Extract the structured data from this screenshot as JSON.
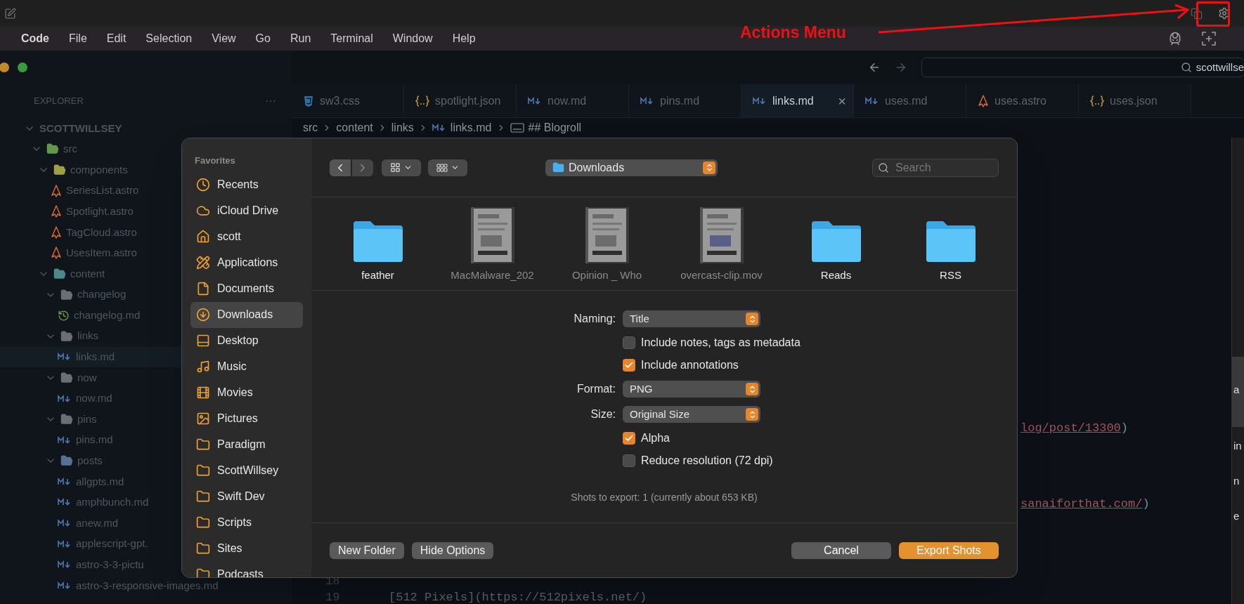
{
  "menu_bar": {
    "app_name": "Code",
    "menus": [
      "File",
      "Edit",
      "Selection",
      "View",
      "Go",
      "Run",
      "Terminal",
      "Window",
      "Help"
    ]
  },
  "annotation": {
    "text": "Actions Menu"
  },
  "command_center": {
    "value": "scottwillse"
  },
  "explorer": {
    "title": "EXPLORER",
    "more": "···",
    "root": {
      "label": "SCOTTWILLSEY",
      "kind": "root",
      "expanded": true,
      "children": [
        {
          "label": "src",
          "kind": "folder",
          "color": "#5f9a4a",
          "expanded": true,
          "selected": false,
          "children": [
            {
              "label": "components",
              "kind": "folder",
              "color": "#a0a040",
              "expanded": true,
              "selected": false,
              "children": [
                {
                  "label": "SeriesList.astro",
                  "kind": "astro",
                  "selected": false
                },
                {
                  "label": "Spotlight.astro",
                  "kind": "astro",
                  "selected": false
                },
                {
                  "label": "TagCloud.astro",
                  "kind": "astro",
                  "selected": false
                },
                {
                  "label": "UsesItem.astro",
                  "kind": "astro",
                  "selected": false
                }
              ]
            },
            {
              "label": "content",
              "kind": "folder",
              "color": "#4a8a8a",
              "expanded": true,
              "selected": false,
              "children": [
                {
                  "label": "changelog",
                  "kind": "folder",
                  "color": "#6a6f75",
                  "expanded": true,
                  "selected": false,
                  "children": [
                    {
                      "label": "changelog.md",
                      "kind": "changelog",
                      "selected": false
                    }
                  ]
                },
                {
                  "label": "links",
                  "kind": "folder",
                  "color": "#6a6f75",
                  "expanded": true,
                  "selected": false,
                  "children": [
                    {
                      "label": "links.md",
                      "kind": "md",
                      "selected": true
                    }
                  ]
                },
                {
                  "label": "now",
                  "kind": "folder",
                  "color": "#6a6f75",
                  "expanded": true,
                  "selected": false,
                  "children": [
                    {
                      "label": "now.md",
                      "kind": "md",
                      "selected": false
                    }
                  ]
                },
                {
                  "label": "pins",
                  "kind": "folder",
                  "color": "#6a6f75",
                  "expanded": true,
                  "selected": false,
                  "children": [
                    {
                      "label": "pins.md",
                      "kind": "md",
                      "selected": false
                    }
                  ]
                },
                {
                  "label": "posts",
                  "kind": "folder",
                  "color": "#5a7090",
                  "expanded": true,
                  "selected": false,
                  "children": [
                    {
                      "label": "allgpts.md",
                      "kind": "md",
                      "selected": false
                    },
                    {
                      "label": "amphbunch.md",
                      "kind": "md",
                      "selected": false
                    },
                    {
                      "label": "anew.md",
                      "kind": "md",
                      "selected": false
                    },
                    {
                      "label": "applescript-gpt.",
                      "kind": "md",
                      "selected": false
                    },
                    {
                      "label": "astro-3-3-pictu",
                      "kind": "md",
                      "selected": false
                    },
                    {
                      "label": "astro-3-responsive-images.md",
                      "kind": "md",
                      "selected": false
                    }
                  ]
                }
              ]
            }
          ]
        }
      ]
    }
  },
  "tabs": [
    {
      "label": "sw3.css",
      "kind": "css",
      "selected": false
    },
    {
      "label": "spotlight.json",
      "kind": "json",
      "selected": false
    },
    {
      "label": "now.md",
      "kind": "md",
      "selected": false
    },
    {
      "label": "pins.md",
      "kind": "md",
      "selected": false
    },
    {
      "label": "links.md",
      "kind": "md",
      "selected": true,
      "close": "×"
    },
    {
      "label": "uses.md",
      "kind": "md",
      "selected": false
    },
    {
      "label": "uses.astro",
      "kind": "astro",
      "selected": false
    },
    {
      "label": "uses.json",
      "kind": "json",
      "selected": false
    }
  ],
  "breadcrumb": [
    {
      "label": "src",
      "kind": "folder"
    },
    {
      "label": "content",
      "kind": "folder"
    },
    {
      "label": "links",
      "kind": "folder"
    },
    {
      "label": "links.md",
      "kind": "md"
    },
    {
      "label": "## Blogroll",
      "kind": "heading"
    }
  ],
  "editor_lines": [
    {
      "link": "log/post/13300",
      "punct": ")"
    },
    {
      "link": "sanaiforthat.com/",
      "punct": ")"
    },
    {
      "number": "18"
    },
    {
      "number": "19",
      "text": "[512 Pixels](https://512pixels.net/)"
    }
  ],
  "right_panel": [
    "a",
    "in",
    "n",
    "e"
  ],
  "dialog": {
    "sidebar": {
      "heading": "Favorites",
      "items": [
        {
          "label": "Recents",
          "selected": false
        },
        {
          "label": "iCloud Drive",
          "selected": false
        },
        {
          "label": "scott",
          "selected": false
        },
        {
          "label": "Applications",
          "selected": false
        },
        {
          "label": "Documents",
          "selected": false
        },
        {
          "label": "Downloads",
          "selected": true
        },
        {
          "label": "Desktop",
          "selected": false
        },
        {
          "label": "Music",
          "selected": false
        },
        {
          "label": "Movies",
          "selected": false
        },
        {
          "label": "Pictures",
          "selected": false
        },
        {
          "label": "Paradigm",
          "selected": false
        },
        {
          "label": "ScottWillsey",
          "selected": false
        },
        {
          "label": "Swift Dev",
          "selected": false
        },
        {
          "label": "Scripts",
          "selected": false
        },
        {
          "label": "Sites",
          "selected": false
        },
        {
          "label": "Podcasts",
          "selected": false
        }
      ]
    },
    "location": "Downloads",
    "search": {
      "placeholder": "Search"
    },
    "files": [
      {
        "name": "feather",
        "kind": "folder",
        "disabled": false
      },
      {
        "name": "MacMalware_202",
        "kind": "document",
        "disabled": true
      },
      {
        "name": "Opinion _ Who",
        "kind": "document",
        "disabled": true
      },
      {
        "name": "overcast-clip.mov",
        "kind": "video",
        "disabled": true
      },
      {
        "name": "Reads",
        "kind": "folder",
        "disabled": false
      },
      {
        "name": "RSS",
        "kind": "folder",
        "disabled": false
      }
    ],
    "options": [
      {
        "kind": "popup",
        "label": "Naming:",
        "value": "Title"
      },
      {
        "kind": "checkbox",
        "label": "Include notes, tags as metadata",
        "checked": false
      },
      {
        "kind": "checkbox",
        "label": "Include annotations",
        "checked": true
      },
      {
        "kind": "popup",
        "label": "Format:",
        "value": "PNG"
      },
      {
        "kind": "popup",
        "label": "Size:",
        "value": "Original Size"
      },
      {
        "kind": "checkbox",
        "label": "Alpha",
        "checked": true
      },
      {
        "kind": "checkbox",
        "label": "Reduce resolution (72 dpi)",
        "checked": false
      }
    ],
    "summary": "Shots to export: 1 (currently about 653 KB)",
    "left_buttons": [
      "New Folder",
      "Hide Options"
    ],
    "right_buttons": [
      {
        "label": "Cancel",
        "default": false
      },
      {
        "label": "Export Shots",
        "default": true
      }
    ]
  }
}
